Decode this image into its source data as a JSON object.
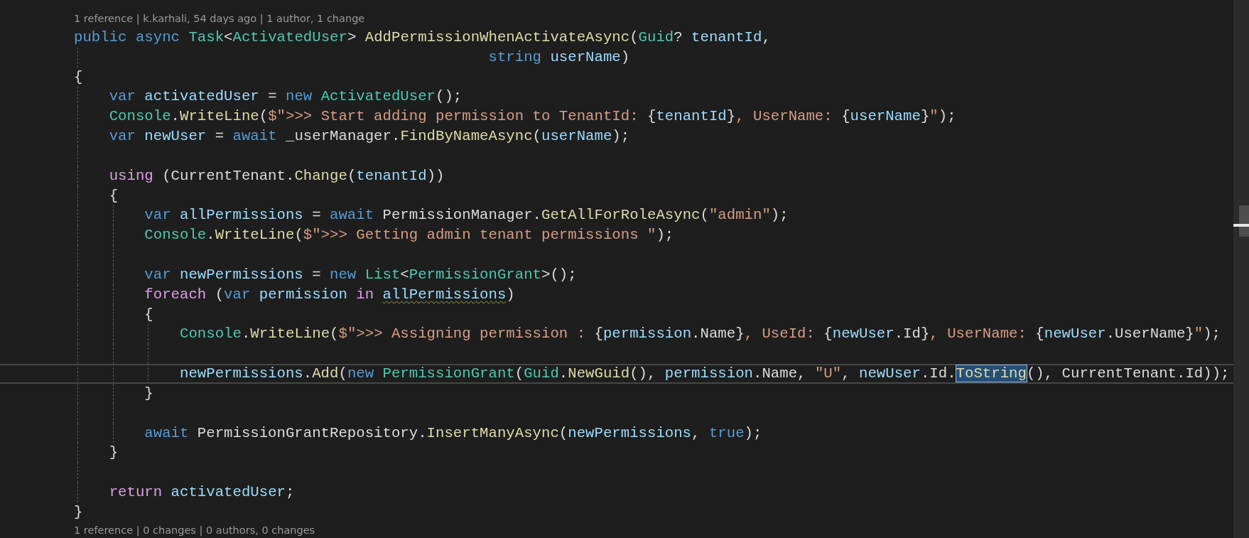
{
  "codelens_top": "1 reference | k.karhali, 54 days ago | 1 author, 1 change",
  "lines": [
    {
      "current": false,
      "tokens": [
        {
          "kind": "kw",
          "t": "public"
        },
        {
          "kind": "kw",
          "t": " async"
        },
        {
          "kind": "type",
          "t": " Task"
        },
        {
          "kind": "p",
          "t": "<"
        },
        {
          "kind": "type",
          "t": "ActivatedUser"
        },
        {
          "kind": "p",
          "t": "> "
        },
        {
          "kind": "fn",
          "t": "AddPermissionWhenActivateAsync"
        },
        {
          "kind": "p",
          "t": "("
        },
        {
          "kind": "type",
          "t": "Guid"
        },
        {
          "kind": "p",
          "t": "? "
        },
        {
          "kind": "var",
          "t": "tenantId"
        },
        {
          "kind": "p",
          "t": ","
        }
      ]
    },
    {
      "current": false,
      "tokens": [
        {
          "kind": "kw",
          "t": "                                               string"
        },
        {
          "kind": "var",
          "t": " userName"
        },
        {
          "kind": "p",
          "t": ")"
        }
      ]
    },
    {
      "current": false,
      "tokens": [
        {
          "kind": "p",
          "t": "{"
        }
      ]
    },
    {
      "current": false,
      "tokens": [
        {
          "kind": "kw",
          "t": "    var"
        },
        {
          "kind": "var",
          "t": " activatedUser"
        },
        {
          "kind": "p",
          "t": " = "
        },
        {
          "kind": "kw",
          "t": "new"
        },
        {
          "kind": "type",
          "t": " ActivatedUser"
        },
        {
          "kind": "p",
          "t": "();"
        }
      ]
    },
    {
      "current": false,
      "tokens": [
        {
          "kind": "type",
          "t": "    Console"
        },
        {
          "kind": "p",
          "t": "."
        },
        {
          "kind": "fn",
          "t": "WriteLine"
        },
        {
          "kind": "p",
          "t": "("
        },
        {
          "kind": "str",
          "t": "$\">>> Start adding permission to TenantId: "
        },
        {
          "kind": "p",
          "t": "{"
        },
        {
          "kind": "var",
          "t": "tenantId"
        },
        {
          "kind": "p",
          "t": "}"
        },
        {
          "kind": "str",
          "t": ", UserName: "
        },
        {
          "kind": "p",
          "t": "{"
        },
        {
          "kind": "var",
          "t": "userName"
        },
        {
          "kind": "p",
          "t": "}"
        },
        {
          "kind": "str",
          "t": "\""
        },
        {
          "kind": "p",
          "t": ");"
        }
      ]
    },
    {
      "current": false,
      "tokens": [
        {
          "kind": "kw",
          "t": "    var"
        },
        {
          "kind": "var",
          "t": " newUser"
        },
        {
          "kind": "p",
          "t": " = "
        },
        {
          "kind": "kw",
          "t": "await"
        },
        {
          "kind": "p",
          "t": " _userManager."
        },
        {
          "kind": "fn",
          "t": "FindByNameAsync"
        },
        {
          "kind": "p",
          "t": "("
        },
        {
          "kind": "var",
          "t": "userName"
        },
        {
          "kind": "p",
          "t": ");"
        }
      ]
    },
    {
      "current": false
    },
    {
      "current": false,
      "tokens": [
        {
          "kind": "ctrl",
          "t": "    using"
        },
        {
          "kind": "p",
          "t": " (CurrentTenant."
        },
        {
          "kind": "fn",
          "t": "Change"
        },
        {
          "kind": "p",
          "t": "("
        },
        {
          "kind": "var",
          "t": "tenantId"
        },
        {
          "kind": "p",
          "t": "))"
        }
      ]
    },
    {
      "current": false,
      "tokens": [
        {
          "kind": "p",
          "t": "    {"
        }
      ]
    },
    {
      "current": false,
      "tokens": [
        {
          "kind": "kw",
          "t": "        var"
        },
        {
          "kind": "var",
          "t": " allPermissions"
        },
        {
          "kind": "p",
          "t": " = "
        },
        {
          "kind": "kw",
          "t": "await"
        },
        {
          "kind": "p",
          "t": " PermissionManager."
        },
        {
          "kind": "fn",
          "t": "GetAllForRoleAsync"
        },
        {
          "kind": "p",
          "t": "("
        },
        {
          "kind": "str",
          "t": "\"admin\""
        },
        {
          "kind": "p",
          "t": ");"
        }
      ]
    },
    {
      "current": false,
      "tokens": [
        {
          "kind": "type",
          "t": "        Console"
        },
        {
          "kind": "p",
          "t": "."
        },
        {
          "kind": "fn",
          "t": "WriteLine"
        },
        {
          "kind": "p",
          "t": "("
        },
        {
          "kind": "str",
          "t": "$\">>> Getting admin tenant permissions \""
        },
        {
          "kind": "p",
          "t": ");"
        }
      ]
    },
    {
      "current": false
    },
    {
      "current": false,
      "tokens": [
        {
          "kind": "kw",
          "t": "        var"
        },
        {
          "kind": "var",
          "t": " newPermissions"
        },
        {
          "kind": "p",
          "t": " = "
        },
        {
          "kind": "kw",
          "t": "new"
        },
        {
          "kind": "type",
          "t": " List"
        },
        {
          "kind": "p",
          "t": "<"
        },
        {
          "kind": "type",
          "t": "PermissionGrant"
        },
        {
          "kind": "p",
          "t": ">();"
        }
      ]
    },
    {
      "current": false,
      "tokens": [
        {
          "kind": "ctrl",
          "t": "        foreach"
        },
        {
          "kind": "p",
          "t": " ("
        },
        {
          "kind": "kw",
          "t": "var"
        },
        {
          "kind": "var",
          "t": " permission"
        },
        {
          "kind": "ctrl",
          "t": " in "
        },
        {
          "kind": "var",
          "t": "allPermissions",
          "warning": true
        },
        {
          "kind": "p",
          "t": ")"
        }
      ]
    },
    {
      "current": false,
      "tokens": [
        {
          "kind": "p",
          "t": "        {"
        }
      ]
    },
    {
      "current": false,
      "tokens": [
        {
          "kind": "type",
          "t": "            Console"
        },
        {
          "kind": "p",
          "t": "."
        },
        {
          "kind": "fn",
          "t": "WriteLine"
        },
        {
          "kind": "p",
          "t": "("
        },
        {
          "kind": "str",
          "t": "$\">>> Assigning permission : "
        },
        {
          "kind": "p",
          "t": "{"
        },
        {
          "kind": "var",
          "t": "permission"
        },
        {
          "kind": "p",
          "t": ".Name}"
        },
        {
          "kind": "str",
          "t": ", UseId: "
        },
        {
          "kind": "p",
          "t": "{"
        },
        {
          "kind": "var",
          "t": "newUser"
        },
        {
          "kind": "p",
          "t": ".Id}"
        },
        {
          "kind": "str",
          "t": ", UserName: "
        },
        {
          "kind": "p",
          "t": "{"
        },
        {
          "kind": "var",
          "t": "newUser"
        },
        {
          "kind": "p",
          "t": ".UserName}"
        },
        {
          "kind": "str",
          "t": "\""
        },
        {
          "kind": "p",
          "t": ");"
        }
      ]
    },
    {
      "current": false
    },
    {
      "current": true,
      "tokens": [
        {
          "kind": "var",
          "t": "            newPermissions"
        },
        {
          "kind": "p",
          "t": "."
        },
        {
          "kind": "fn",
          "t": "Add"
        },
        {
          "kind": "p",
          "t": "("
        },
        {
          "kind": "kw",
          "t": "new"
        },
        {
          "kind": "type",
          "t": " PermissionGrant"
        },
        {
          "kind": "p",
          "t": "("
        },
        {
          "kind": "type",
          "t": "Guid"
        },
        {
          "kind": "p",
          "t": "."
        },
        {
          "kind": "fn",
          "t": "NewGuid"
        },
        {
          "kind": "p",
          "t": "(), "
        },
        {
          "kind": "var",
          "t": "permission"
        },
        {
          "kind": "p",
          "t": ".Name, "
        },
        {
          "kind": "str",
          "t": "\"U\""
        },
        {
          "kind": "p",
          "t": ", "
        },
        {
          "kind": "var",
          "t": "newUser"
        },
        {
          "kind": "p",
          "t": ".Id."
        },
        {
          "kind": "fn",
          "t": "ToString",
          "selection": true
        },
        {
          "kind": "p",
          "t": "(), CurrentTenant.Id));"
        }
      ]
    },
    {
      "current": false,
      "tokens": [
        {
          "kind": "p",
          "t": "        }"
        }
      ]
    },
    {
      "current": false
    },
    {
      "current": false,
      "tokens": [
        {
          "kind": "kw",
          "t": "        await"
        },
        {
          "kind": "p",
          "t": " PermissionGrantRepository."
        },
        {
          "kind": "fn",
          "t": "InsertManyAsync"
        },
        {
          "kind": "p",
          "t": "("
        },
        {
          "kind": "var",
          "t": "newPermissions"
        },
        {
          "kind": "p",
          "t": ", "
        },
        {
          "kind": "kw",
          "t": "true"
        },
        {
          "kind": "p",
          "t": ");"
        }
      ]
    },
    {
      "current": false,
      "tokens": [
        {
          "kind": "p",
          "t": "    }"
        }
      ]
    },
    {
      "current": false
    },
    {
      "current": false,
      "tokens": [
        {
          "kind": "ctrl",
          "t": "    return"
        },
        {
          "kind": "var",
          "t": " activatedUser"
        },
        {
          "kind": "p",
          "t": ";"
        }
      ]
    },
    {
      "current": false,
      "tokens": [
        {
          "kind": "p",
          "t": "}"
        }
      ]
    }
  ],
  "codelens_bottom": "1 reference | 0 changes | 0 authors, 0 changes"
}
